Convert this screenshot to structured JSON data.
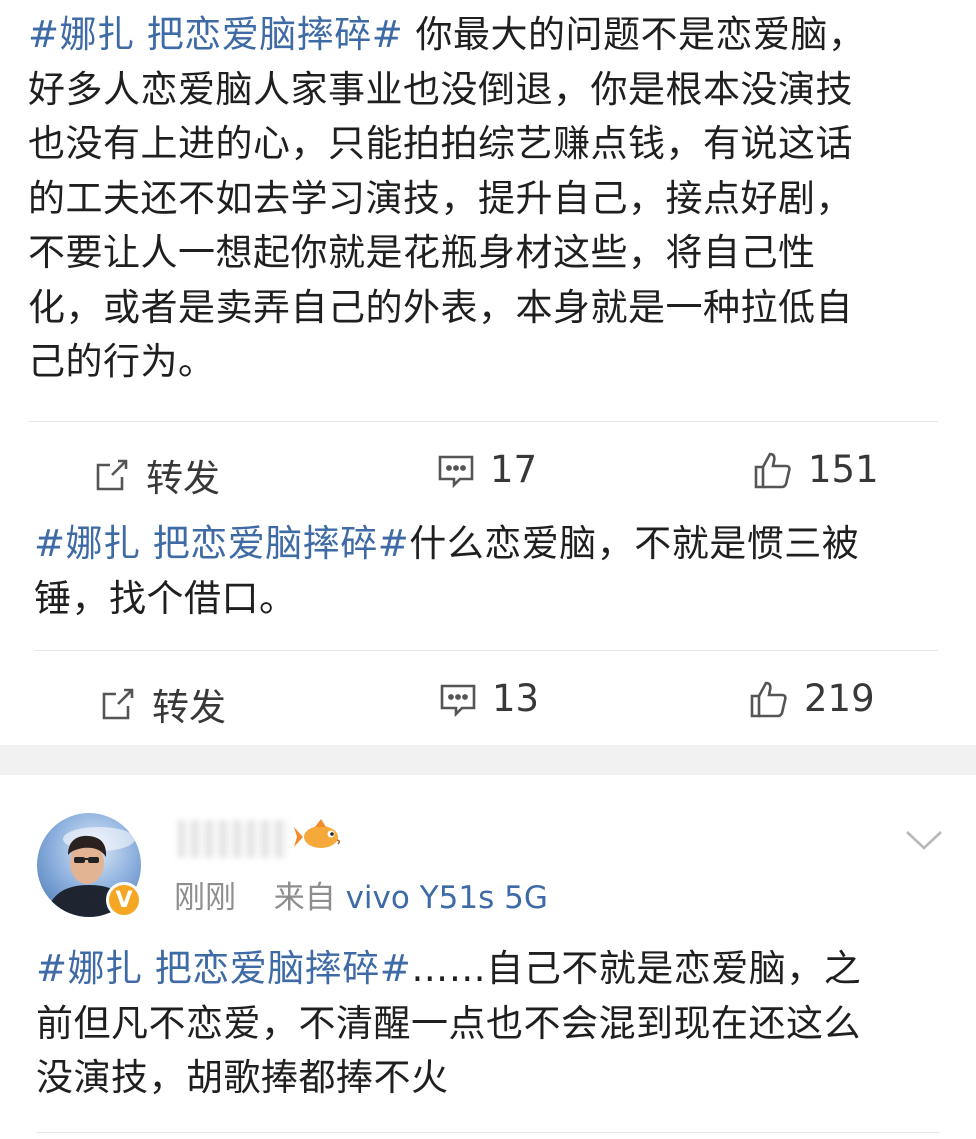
{
  "posts": [
    {
      "hashtag": "#娜扎 把恋爱脑摔碎#",
      "text_lines": [
        " 你最大的问题不是恋爱脑，",
        "好多人恋爱脑人家事业也没倒退，你是根本没演技",
        "也没有上进的心，只能拍拍综艺赚点钱，有说这话",
        "的工夫还不如去学习演技，提升自己，接点好剧，",
        "不要让人一想起你就是花瓶身材这些，将自己性",
        "化，或者是卖弄自己的外表，本身就是一种拉低自",
        "己的行为。"
      ],
      "repost_label": "转发",
      "comment_count": "17",
      "like_count": "151"
    },
    {
      "hashtag": "#娜扎 把恋爱脑摔碎#",
      "text_lines": [
        "什么恋爱脑，不就是惯三被",
        "锤，找个借口。"
      ],
      "repost_label": "转发",
      "comment_count": "13",
      "like_count": "219"
    },
    {
      "time": "刚刚",
      "source_prefix": "来自",
      "device": "vivo Y51s 5G",
      "hashtag": "#娜扎 把恋爱脑摔碎#",
      "text_lines": [
        "……自己不就是恋爱脑，之",
        "前但凡不恋爱，不清醒一点也不会混到现在还这么",
        "没演技，胡歌捧都捧不火"
      ],
      "badge": "V"
    }
  ],
  "icons": [
    "repost-icon",
    "comment-icon",
    "like-icon",
    "chevron-down-icon",
    "verified-badge-icon",
    "fish-emoji-icon"
  ],
  "colors": {
    "hashtag": "#3e6aa5",
    "text": "#1f1f1f",
    "meta": "#8e8e8e",
    "badge": "#f5a623",
    "separator": "#f1f1f1"
  }
}
